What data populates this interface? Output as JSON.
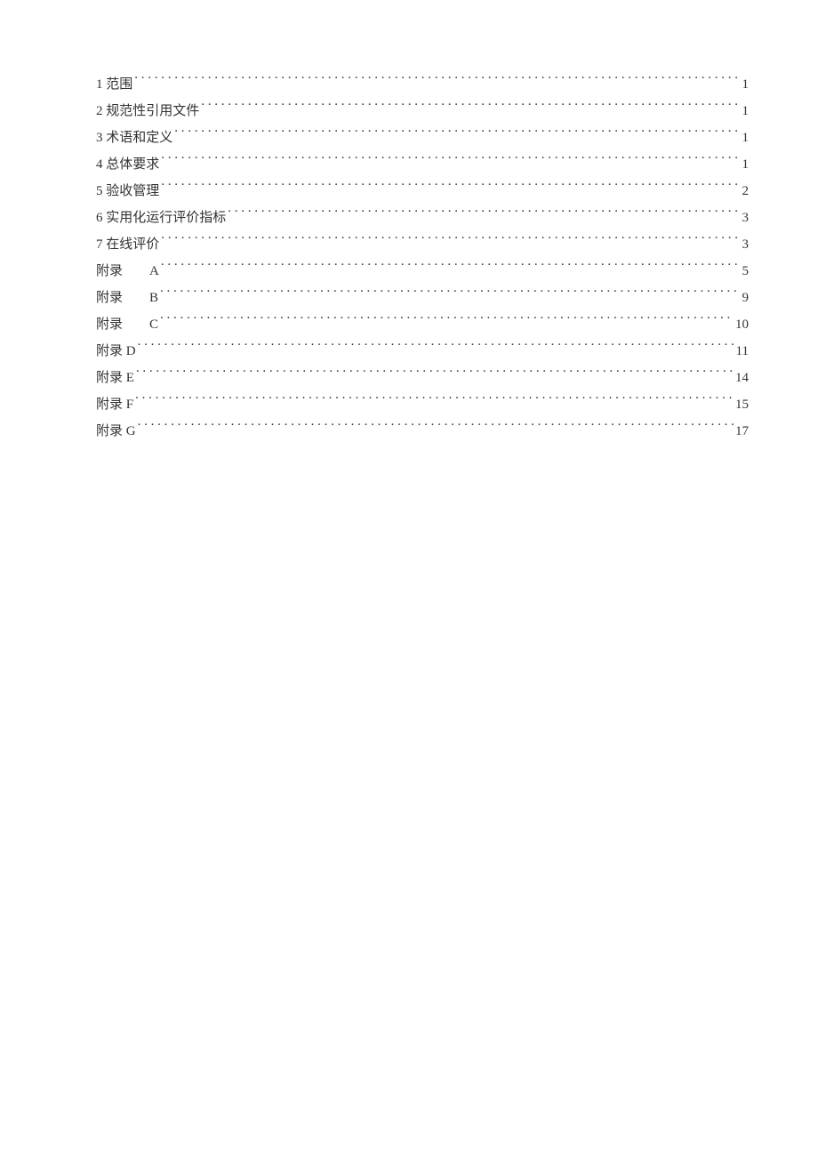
{
  "toc": {
    "items": [
      {
        "label": "1 范围",
        "page": "1",
        "gap": ""
      },
      {
        "label": "2 规范性引用文件",
        "page": "1",
        "gap": ""
      },
      {
        "label": "3 术语和定义",
        "page": "1",
        "gap": ""
      },
      {
        "label": "4 总体要求",
        "page": "1",
        "gap": ""
      },
      {
        "label": "5 验收管理",
        "page": "2",
        "gap": ""
      },
      {
        "label": "6 实用化运行评价指标",
        "page": "3",
        "gap": ""
      },
      {
        "label": "7 在线评价",
        "page": "3",
        "gap": ""
      },
      {
        "label": "附录　　A",
        "page": "5",
        "gap": ""
      },
      {
        "label": "附录　　B",
        "page": "9",
        "gap": ""
      },
      {
        "label": "附录　　C",
        "page": "10",
        "gap": ""
      },
      {
        "label": "附录 D",
        "page": "11",
        "gap": ""
      },
      {
        "label": "附录 E",
        "page": "14",
        "gap": ""
      },
      {
        "label": "附录 F",
        "page": "15",
        "gap": ""
      },
      {
        "label": "附录 G",
        "page": "17",
        "gap": ""
      }
    ]
  }
}
